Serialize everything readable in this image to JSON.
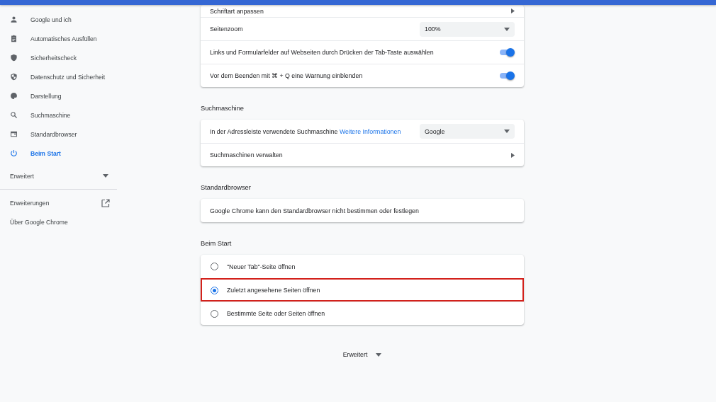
{
  "sidebar": {
    "items": [
      {
        "label": "Google und ich",
        "selected": false
      },
      {
        "label": "Automatisches Ausfüllen",
        "selected": false
      },
      {
        "label": "Sicherheitscheck",
        "selected": false
      },
      {
        "label": "Datenschutz und Sicherheit",
        "selected": false
      },
      {
        "label": "Darstellung",
        "selected": false
      },
      {
        "label": "Suchmaschine",
        "selected": false
      },
      {
        "label": "Standardbrowser",
        "selected": false
      },
      {
        "label": "Beim Start",
        "selected": true
      }
    ],
    "advanced": {
      "label": "Erweitert",
      "expanded": false
    },
    "links": [
      {
        "label": "Erweiterungen",
        "external": true
      },
      {
        "label": "Über Google Chrome",
        "external": false
      }
    ]
  },
  "sections": [
    {
      "rows": [
        {
          "kind": "subpage",
          "label": "Schriftart anpassen"
        },
        {
          "kind": "dropdown",
          "label": "Seitenzoom",
          "value": "100%"
        },
        {
          "kind": "toggle",
          "label": "Links und Formularfelder auf Webseiten durch Drücken der Tab-Taste auswählen",
          "on": true
        },
        {
          "kind": "toggle",
          "label": "Vor dem Beenden mit ⌘ + Q eine Warnung einblenden",
          "on": true
        }
      ]
    },
    {
      "heading": "Suchmaschine",
      "rows": [
        {
          "kind": "dropdown",
          "label": "In der Adressleiste verwendete Suchmaschine",
          "link": "Weitere Informationen",
          "value": "Google"
        },
        {
          "kind": "subpage",
          "label": "Suchmaschinen verwalten"
        }
      ]
    },
    {
      "heading": "Standardbrowser",
      "rows": [
        {
          "kind": "text",
          "label": "Google Chrome kann den Standardbrowser nicht bestimmen oder festlegen"
        }
      ]
    },
    {
      "heading": "Beim Start",
      "rows": [
        {
          "kind": "radio",
          "label": "\"Neuer Tab\"-Seite öffnen",
          "selected": false,
          "highlighted": false
        },
        {
          "kind": "radio",
          "label": "Zuletzt angesehene Seiten öffnen",
          "selected": true,
          "highlighted": true
        },
        {
          "kind": "radio",
          "label": "Bestimmte Seite oder Seiten öffnen",
          "selected": false,
          "highlighted": false
        }
      ]
    }
  ],
  "advanced_button": {
    "label": "Erweitert",
    "expanded": false
  }
}
